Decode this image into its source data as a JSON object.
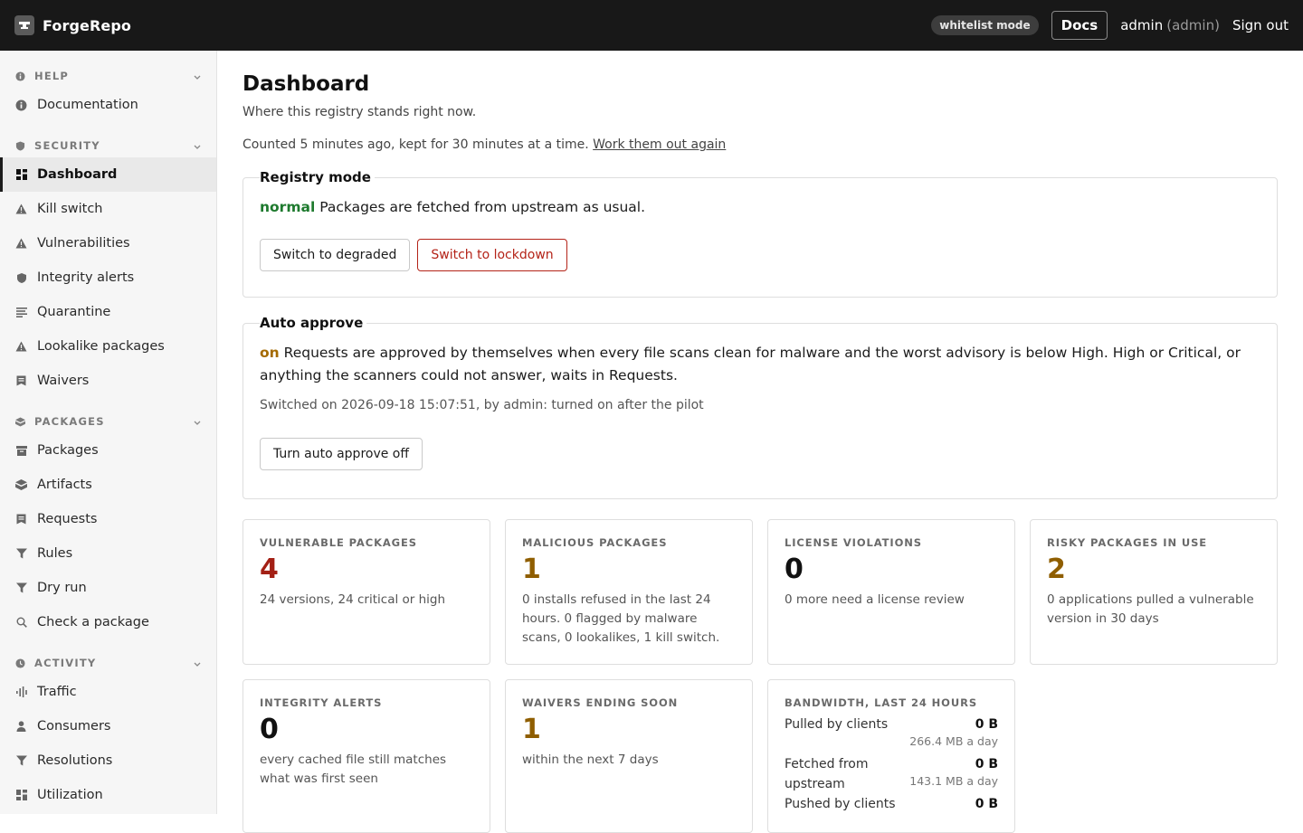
{
  "app": {
    "name": "ForgeRepo"
  },
  "header": {
    "mode_badge": "whitelist mode",
    "docs_label": "Docs",
    "user": "admin",
    "role": "(admin)",
    "sign_out": "Sign out"
  },
  "sidebar": {
    "groups": [
      {
        "label": "HELP",
        "icon": "info-icon",
        "items": [
          {
            "label": "Documentation",
            "icon": "info-icon"
          }
        ]
      },
      {
        "label": "SECURITY",
        "icon": "shield-icon",
        "items": [
          {
            "label": "Dashboard",
            "icon": "grid-icon",
            "active": true
          },
          {
            "label": "Kill switch",
            "icon": "warning-icon"
          },
          {
            "label": "Vulnerabilities",
            "icon": "warning-icon"
          },
          {
            "label": "Integrity alerts",
            "icon": "shield-icon"
          },
          {
            "label": "Quarantine",
            "icon": "lines-icon"
          },
          {
            "label": "Lookalike packages",
            "icon": "warning-icon"
          },
          {
            "label": "Waivers",
            "icon": "note-icon"
          }
        ]
      },
      {
        "label": "PACKAGES",
        "icon": "box-icon",
        "items": [
          {
            "label": "Packages",
            "icon": "box-icon"
          },
          {
            "label": "Artifacts",
            "icon": "cube-icon"
          },
          {
            "label": "Requests",
            "icon": "note-icon"
          },
          {
            "label": "Rules",
            "icon": "filter-icon"
          },
          {
            "label": "Dry run",
            "icon": "filter-icon"
          },
          {
            "label": "Check a package",
            "icon": "search-icon"
          }
        ]
      },
      {
        "label": "ACTIVITY",
        "icon": "clock-icon",
        "items": [
          {
            "label": "Traffic",
            "icon": "bars-icon"
          },
          {
            "label": "Consumers",
            "icon": "person-icon"
          },
          {
            "label": "Resolutions",
            "icon": "filter-icon"
          },
          {
            "label": "Utilization",
            "icon": "grid-icon"
          }
        ]
      }
    ]
  },
  "main": {
    "title": "Dashboard",
    "subtitle": "Where this registry stands right now.",
    "counted_text": "Counted 5 minutes ago, kept for 30 minutes at a time.",
    "recount_link": "Work them out again",
    "registry_mode": {
      "legend": "Registry mode",
      "state": "normal",
      "description": "Packages are fetched from upstream as usual.",
      "btn_degraded": "Switch to degraded",
      "btn_lockdown": "Switch to lockdown"
    },
    "auto_approve": {
      "legend": "Auto approve",
      "state": "on",
      "description": "Requests are approved by themselves when every file scans clean for malware and the worst advisory is below High. High or Critical, or anything the scanners could not answer, waits in Requests.",
      "switched_note": "Switched on 2026-09-18 15:07:51, by admin: turned on after the pilot",
      "btn_off": "Turn auto approve off"
    },
    "cards": {
      "vulnerable": {
        "label": "VULNERABLE PACKAGES",
        "value": "4",
        "desc": "24 versions, 24 critical or high"
      },
      "malicious": {
        "label": "MALICIOUS PACKAGES",
        "value": "1",
        "desc": "0 installs refused in the last 24 hours. 0 flagged by malware scans, 0 lookalikes, 1 kill switch."
      },
      "license": {
        "label": "LICENSE VIOLATIONS",
        "value": "0",
        "desc": "0 more need a license review"
      },
      "risky": {
        "label": "RISKY PACKAGES IN USE",
        "value": "2",
        "desc": "0 applications pulled a vulnerable version in 30 days"
      },
      "integrity": {
        "label": "INTEGRITY ALERTS",
        "value": "0",
        "desc": "every cached file still matches what was first seen"
      },
      "waivers": {
        "label": "WAIVERS ENDING SOON",
        "value": "1",
        "desc": "within the next 7 days"
      },
      "bandwidth": {
        "label": "BANDWIDTH, LAST 24 HOURS",
        "rows": [
          {
            "label": "Pulled by clients",
            "value": "0 B",
            "sub": "266.4 MB a day"
          },
          {
            "label": "Fetched from upstream",
            "value": "0 B",
            "sub": "143.1 MB a day"
          },
          {
            "label": "Pushed by clients",
            "value": "0 B",
            "sub": ""
          }
        ]
      }
    }
  },
  "colors": {
    "topbar": "#181818",
    "ok": "#1e7a2e",
    "warn": "#a46a00",
    "danger": "#b42318"
  }
}
